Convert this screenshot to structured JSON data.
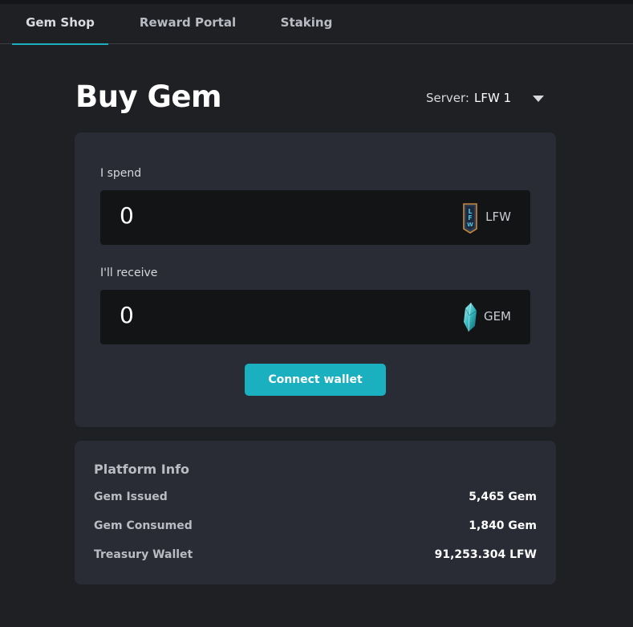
{
  "nav": {
    "tabs": [
      {
        "label": "Gem Shop",
        "active": true
      },
      {
        "label": "Reward Portal",
        "active": false
      },
      {
        "label": "Staking",
        "active": false
      }
    ]
  },
  "header": {
    "title": "Buy Gem",
    "server_label": "Server:",
    "server_value": "LFW 1"
  },
  "buy": {
    "spend_label": "I spend",
    "spend_amount": "0",
    "spend_token": "LFW",
    "spend_icon": "lfw-token-icon",
    "receive_label": "I'll receive",
    "receive_amount": "0",
    "receive_token": "GEM",
    "receive_icon": "gem-crystal-icon",
    "connect_label": "Connect wallet"
  },
  "platform_info": {
    "title": "Platform Info",
    "rows": [
      {
        "label": "Gem Issued",
        "value": "5,465 Gem"
      },
      {
        "label": "Gem Consumed",
        "value": "1,840 Gem"
      },
      {
        "label": "Treasury Wallet",
        "value": "91,253.304 LFW"
      }
    ]
  },
  "colors": {
    "accent": "#1ab0c0",
    "background": "#1f2024",
    "card": "#292c35",
    "input": "#131416"
  }
}
